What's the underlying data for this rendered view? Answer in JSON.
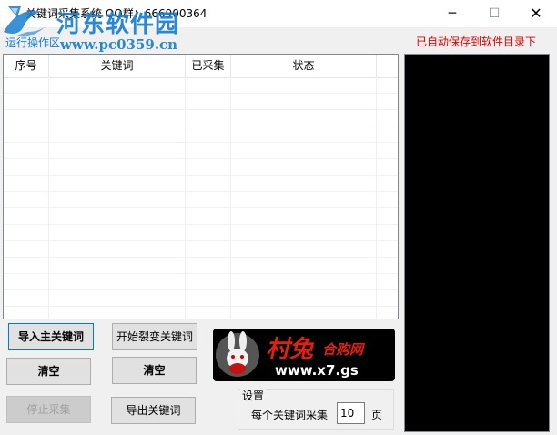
{
  "window": {
    "title": "关键词采集系统 QQ群：666900364",
    "min_glyph": "─",
    "max_glyph": "☐",
    "close_glyph": "✕"
  },
  "watermark": {
    "line1": "河东软件园",
    "line2": "www.pc0359.cn"
  },
  "area_label": "运行操作区",
  "save_notice": "已自动保存到软件目录下",
  "table": {
    "columns": [
      "序号",
      "关键词",
      "已采集",
      "状态"
    ],
    "rows": []
  },
  "buttons": {
    "import_main": "导入主关键词",
    "start_split": "开始裂变关键词",
    "clear_left": "清空",
    "clear_right": "清空",
    "stop_collect": "停止采集",
    "export": "导出关键词"
  },
  "ad": {
    "brand": "村兔",
    "tagline": "合购网",
    "url": "www.x7.gs"
  },
  "settings": {
    "legend": "设置",
    "per_keyword_label": "每个关键词采集",
    "pages_value": "10",
    "pages_unit": "页"
  },
  "colors": {
    "accent_blue": "#1a7fd0",
    "notice_red": "#e00000",
    "ad_red": "#e02010"
  }
}
